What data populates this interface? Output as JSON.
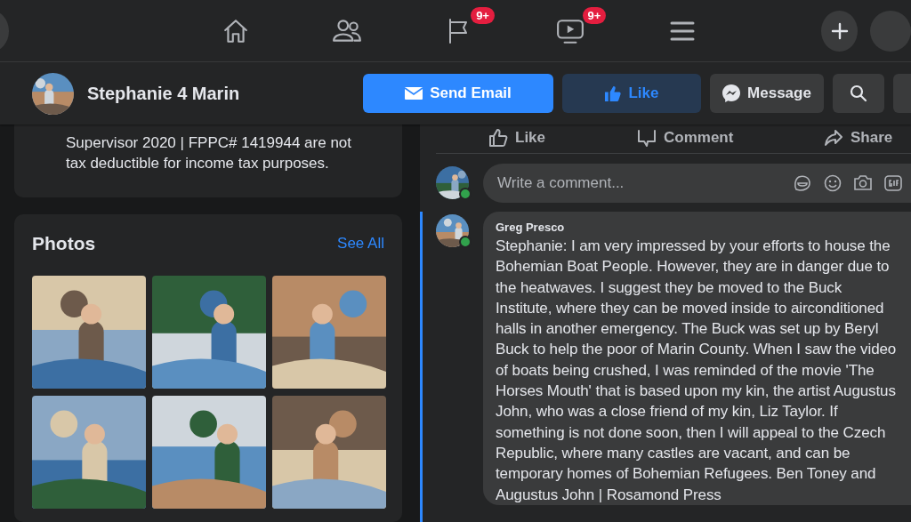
{
  "nav": {
    "items": [
      {
        "kind": "back"
      },
      {
        "kind": "home"
      },
      {
        "kind": "friends"
      },
      {
        "kind": "flag",
        "badge": "9+"
      },
      {
        "kind": "video",
        "badge": "9+"
      },
      {
        "kind": "menu"
      },
      {
        "kind": "create"
      },
      {
        "kind": "edge"
      }
    ]
  },
  "page_header": {
    "name": "Stephanie 4 Marin",
    "buttons": [
      {
        "label": "Send Email",
        "kind": "email"
      },
      {
        "label": "Like",
        "kind": "like"
      },
      {
        "label": "Message",
        "kind": "message"
      },
      {
        "kind": "search"
      },
      {
        "kind": "edge"
      }
    ]
  },
  "about_card": {
    "text": "Supervisor 2020 | FPPC# 1419944 are not tax deductible for income tax purposes."
  },
  "photos": {
    "title": "Photos",
    "see_all": "See All"
  },
  "post_actions": [
    {
      "label": "Like",
      "kind": "like"
    },
    {
      "label": "Comment",
      "kind": "comment"
    },
    {
      "label": "Share",
      "kind": "share"
    }
  ],
  "composer": {
    "placeholder": "Write a comment...",
    "online": true,
    "tools": [
      {
        "kind": "sticker"
      },
      {
        "kind": "emoji"
      },
      {
        "kind": "camera"
      },
      {
        "kind": "gif"
      }
    ]
  },
  "comments": [
    {
      "author": "Greg Presco",
      "online": true,
      "text": "Stephanie: I am very impressed by your efforts to house the Bohemian Boat People. However, they are in danger due to the heatwaves. I suggest they be moved to the Buck Institute, where they can be moved inside to airconditioned halls in another emergency. The Buck was set up by Beryl Buck to help the poor of Marin County. When I saw the video of boats being crushed, I was reminded of the movie 'The Horses Mouth' that is based upon my kin, the artist Augustus John, who was a close friend of my kin, Liz Taylor. If something is not done soon, then I will appeal to the Czech Republic, where many castles are vacant, and can be temporary homes of Bohemian Refugees. Ben Toney and Augustus John | Rosamond Press"
    }
  ]
}
